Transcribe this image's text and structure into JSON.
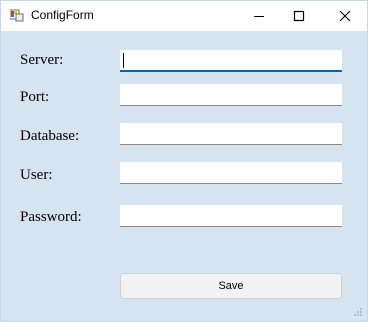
{
  "window": {
    "title": "ConfigForm",
    "controls": {
      "minimize_icon": "minimize-icon",
      "maximize_icon": "maximize-icon",
      "close_icon": "close-icon"
    }
  },
  "form": {
    "fields": [
      {
        "label": "Server:",
        "value": ""
      },
      {
        "label": "Port:",
        "value": ""
      },
      {
        "label": "Database:",
        "value": ""
      },
      {
        "label": "User:",
        "value": ""
      },
      {
        "label": "Password:",
        "value": ""
      }
    ],
    "save_label": "Save"
  },
  "colors": {
    "background": "#d6e3f1",
    "focus_accent": "#0067c0",
    "titlebar": "#ffffff"
  }
}
